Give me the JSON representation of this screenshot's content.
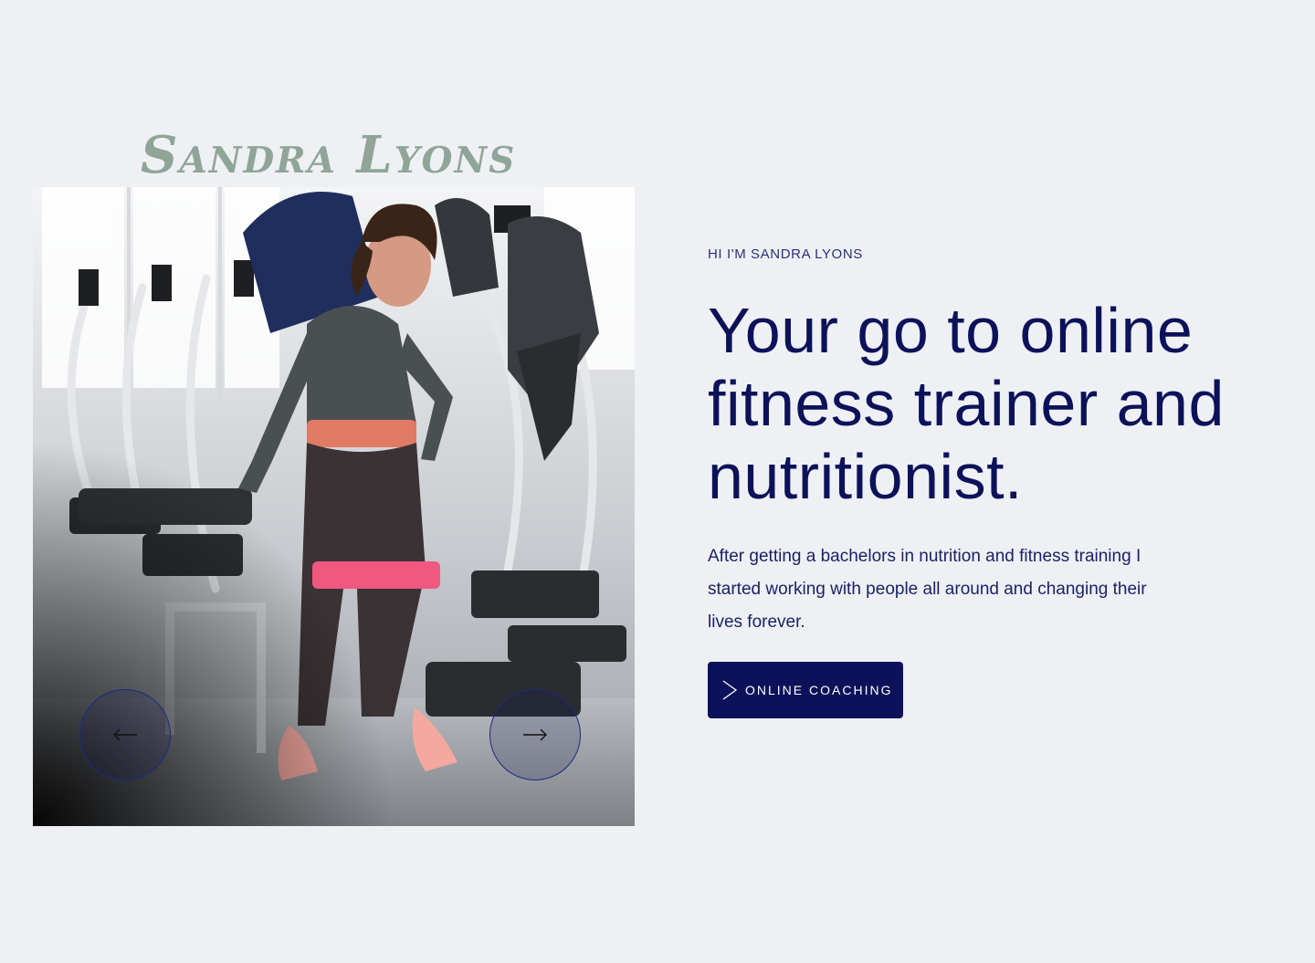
{
  "brand": {
    "name": "Sandra Lyons"
  },
  "hero": {
    "eyebrow": "HI I'M SANDRA LYONS",
    "headline": "Your go to online fitness trainer and nutritionist.",
    "body": "After getting a bachelors in nutrition and fitness training I started working with people all around and changing their lives forever.",
    "cta_label": "ONLINE COACHING",
    "cta_icon": "chevron-right-icon"
  },
  "carousel": {
    "image_alt": "Woman exercising with resistance band in gym",
    "prev_icon": "arrow-left-icon",
    "next_icon": "arrow-right-icon"
  },
  "colors": {
    "background": "#eff0f4",
    "primary": "#0c1259",
    "brand_script": "#8fa597",
    "band_pink": "#f0587f"
  }
}
